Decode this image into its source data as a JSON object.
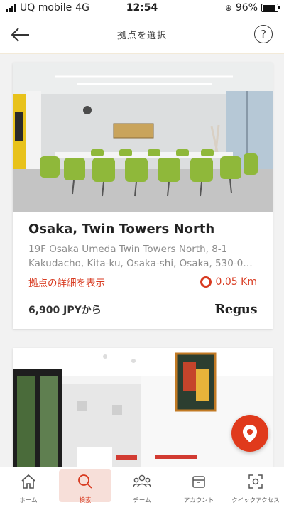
{
  "status": {
    "carrier": "UQ mobile",
    "network": "4G",
    "time": "12:54",
    "battery": "96%"
  },
  "header": {
    "title": "拠点を選択",
    "help": "?"
  },
  "locations": [
    {
      "name": "Osaka, Twin Towers North",
      "address_line1": "19F Osaka Umeda Twin Towers North, 8-1",
      "address_line2": "Kakudacho, Kita-ku, Osaka-shi, Osaka, 530-0…",
      "details_label": "拠点の詳細を表示",
      "distance": "0.05 Km",
      "price": "6,900 JPYから",
      "brand": "Regus"
    }
  ],
  "tabs": [
    {
      "label": "ホーム",
      "icon": "home-icon"
    },
    {
      "label": "検索",
      "icon": "search-icon"
    },
    {
      "label": "チーム",
      "icon": "team-icon"
    },
    {
      "label": "アカウント",
      "icon": "account-icon"
    },
    {
      "label": "クイックアクセス",
      "icon": "qr-scan-icon"
    }
  ],
  "colors": {
    "accent": "#d83a20",
    "fab": "#e03a1c",
    "active_tab_bg": "#f7dfd9"
  }
}
